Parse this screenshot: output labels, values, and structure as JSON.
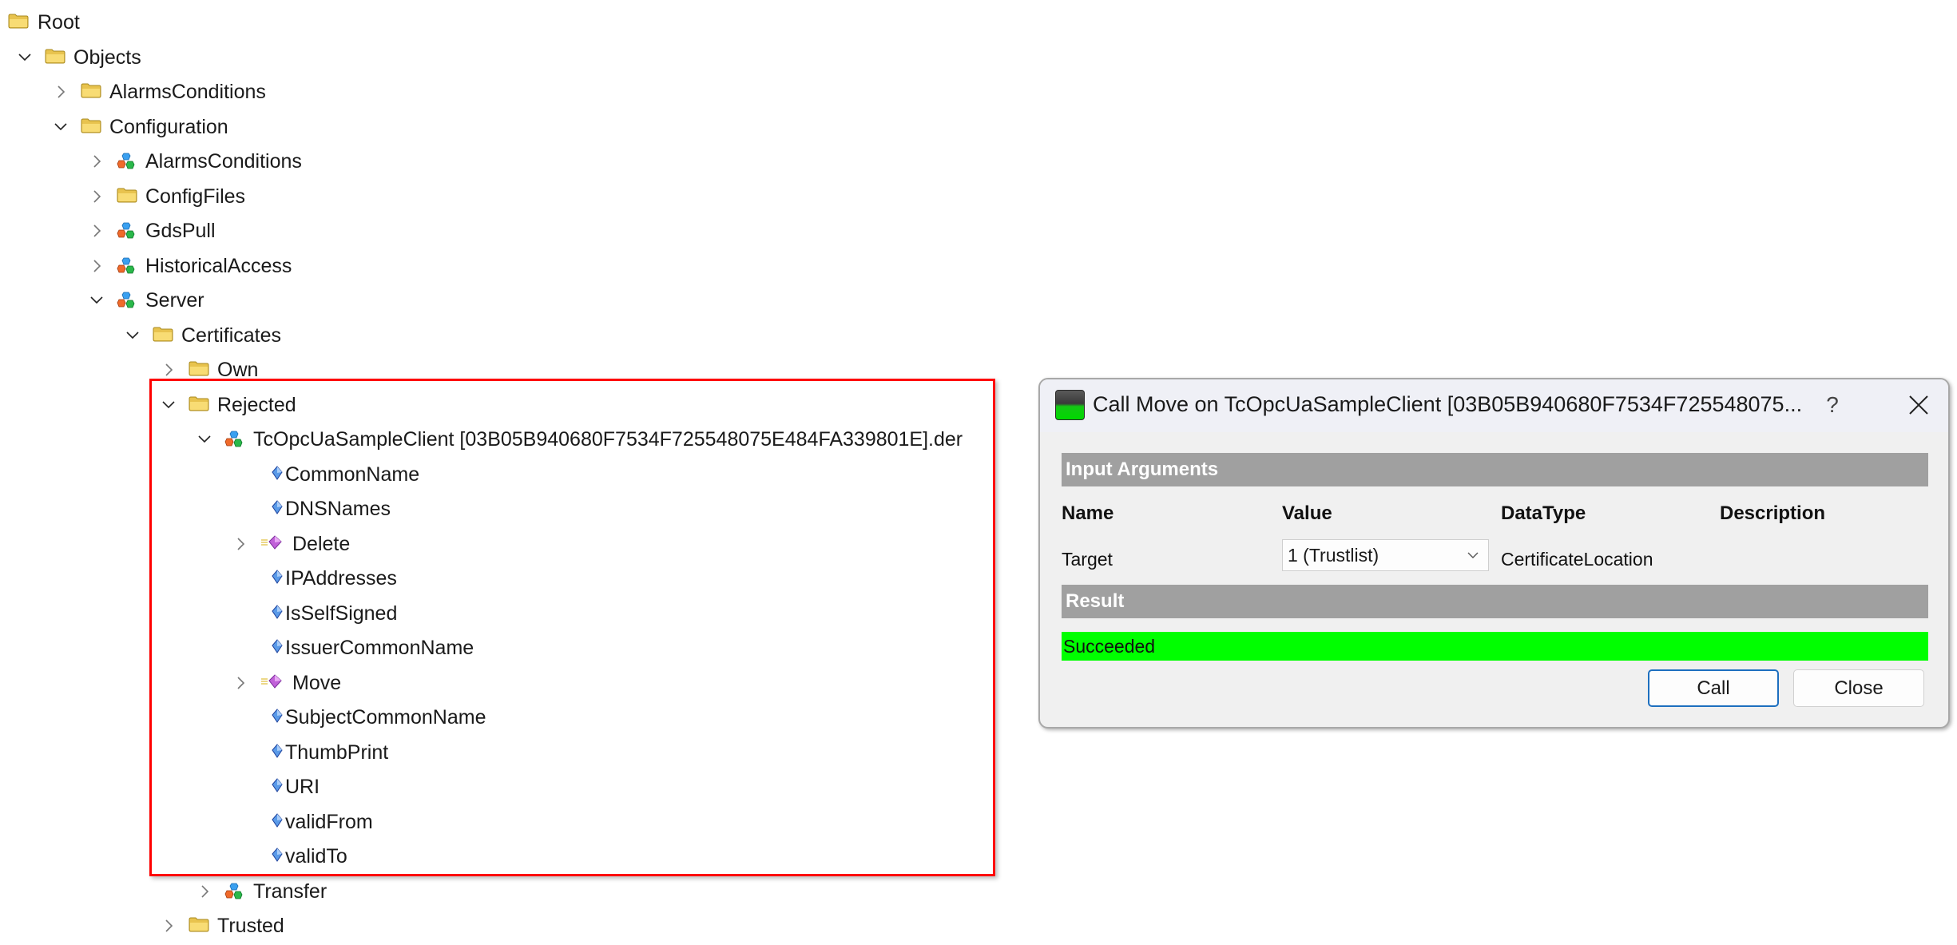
{
  "tree": {
    "rows": [
      {
        "label": "Root",
        "icon": "folder-icon",
        "level": 0,
        "expander": "none"
      },
      {
        "label": "Objects",
        "icon": "folder-icon",
        "level": 1,
        "expander": "expanded"
      },
      {
        "label": "AlarmsConditions",
        "icon": "folder-icon",
        "level": 2,
        "expander": "collapsed"
      },
      {
        "label": "Configuration",
        "icon": "folder-icon",
        "level": 2,
        "expander": "expanded"
      },
      {
        "label": "AlarmsConditions",
        "icon": "object-icon",
        "level": 3,
        "expander": "collapsed"
      },
      {
        "label": "ConfigFiles",
        "icon": "folder-icon",
        "level": 3,
        "expander": "collapsed"
      },
      {
        "label": "GdsPull",
        "icon": "object-icon",
        "level": 3,
        "expander": "collapsed"
      },
      {
        "label": "HistoricalAccess",
        "icon": "object-icon",
        "level": 3,
        "expander": "collapsed"
      },
      {
        "label": "Server",
        "icon": "object-icon",
        "level": 3,
        "expander": "expanded"
      },
      {
        "label": "Certificates",
        "icon": "folder-icon",
        "level": 4,
        "expander": "expanded"
      },
      {
        "label": "Own",
        "icon": "folder-icon",
        "level": 5,
        "expander": "collapsed"
      },
      {
        "label": "Rejected",
        "icon": "folder-icon",
        "level": 5,
        "expander": "expanded"
      },
      {
        "label": "TcOpcUaSampleClient [03B05B940680F7534F725548075E484FA339801E].der",
        "icon": "object-icon",
        "level": 6,
        "expander": "expanded"
      },
      {
        "label": "CommonName",
        "icon": "property-icon",
        "level": 7,
        "expander": "none"
      },
      {
        "label": "DNSNames",
        "icon": "property-icon",
        "level": 7,
        "expander": "none"
      },
      {
        "label": "Delete",
        "icon": "method-icon",
        "level": 7,
        "expander": "collapsed"
      },
      {
        "label": "IPAddresses",
        "icon": "property-icon",
        "level": 7,
        "expander": "none"
      },
      {
        "label": "IsSelfSigned",
        "icon": "property-icon",
        "level": 7,
        "expander": "none"
      },
      {
        "label": "IssuerCommonName",
        "icon": "property-icon",
        "level": 7,
        "expander": "none"
      },
      {
        "label": "Move",
        "icon": "method-icon",
        "level": 7,
        "expander": "collapsed"
      },
      {
        "label": "SubjectCommonName",
        "icon": "property-icon",
        "level": 7,
        "expander": "none"
      },
      {
        "label": "ThumbPrint",
        "icon": "property-icon",
        "level": 7,
        "expander": "none"
      },
      {
        "label": "URI",
        "icon": "property-icon",
        "level": 7,
        "expander": "none"
      },
      {
        "label": "validFrom",
        "icon": "property-icon",
        "level": 7,
        "expander": "none"
      },
      {
        "label": "validTo",
        "icon": "property-icon",
        "level": 7,
        "expander": "none"
      },
      {
        "label": "Transfer",
        "icon": "object-icon",
        "level": 6,
        "expander": "collapsed"
      },
      {
        "label": "Trusted",
        "icon": "folder-icon",
        "level": 5,
        "expander": "collapsed"
      }
    ],
    "highlight_color": "#ff0000"
  },
  "dialog": {
    "title": "Call Move on TcOpcUaSampleClient [03B05B940680F7534F725548075...",
    "app_icon": "ua-expert-icon",
    "help_label": "?",
    "input_section_label": "Input Arguments",
    "columns": [
      "Name",
      "Value",
      "DataType",
      "Description"
    ],
    "arguments": [
      {
        "name": "Target",
        "value": "1 (Trustlist)",
        "datatype": "CertificateLocation",
        "description": ""
      }
    ],
    "result_section_label": "Result",
    "result_text": "Succeeded",
    "result_color": "#00ff00",
    "buttons": {
      "call": "Call",
      "close": "Close"
    }
  }
}
